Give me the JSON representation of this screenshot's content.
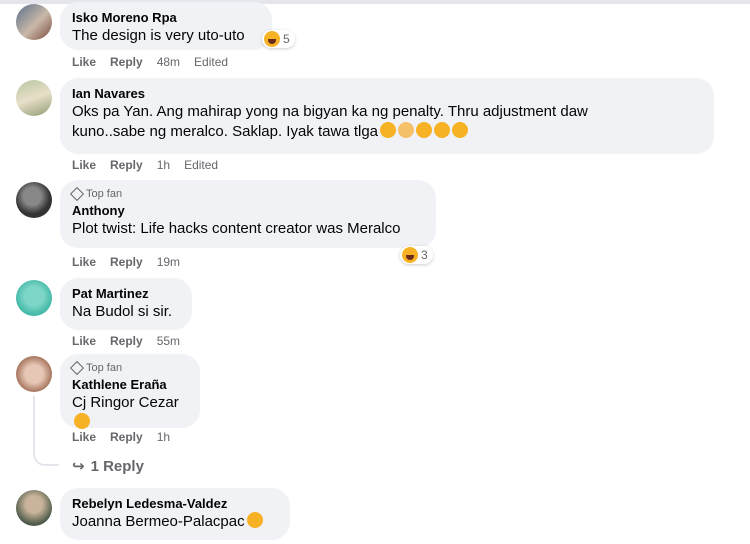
{
  "actions": {
    "like": "Like",
    "reply": "Reply"
  },
  "comments": [
    {
      "name": "Isko Moreno Rpa",
      "text": "The design is very uto-uto",
      "time": "48m",
      "edited": "Edited",
      "reaction_count": "5"
    },
    {
      "name": "Ian Navares",
      "text_line1": "Oks pa Yan. Ang mahirap yong na bigyan ka ng penalty. Thru adjustment daw",
      "text_line2": "kuno..sabe ng meralco. Saklap. Iyak tawa tlga",
      "time": "1h",
      "edited": "Edited"
    },
    {
      "badge": "Top fan",
      "name": "Anthony",
      "text": "Plot twist: Life hacks content creator was Meralco",
      "time": "19m",
      "reaction_count": "3"
    },
    {
      "name": "Pat Martinez",
      "text": "Na Budol si sir.",
      "time": "55m"
    },
    {
      "badge": "Top fan",
      "name": "Kathlene Eraña",
      "text": "Cj Ringor Cezar",
      "time": "1h"
    },
    {
      "name": "Rebelyn Ledesma-Valdez",
      "text": "Joanna Bermeo-Palacpac"
    }
  ],
  "replies_link": "1 Reply",
  "colors": {
    "bubble": "#f0f2f5",
    "meta": "#65676b",
    "text": "#050505",
    "haha": "#f7b125"
  }
}
